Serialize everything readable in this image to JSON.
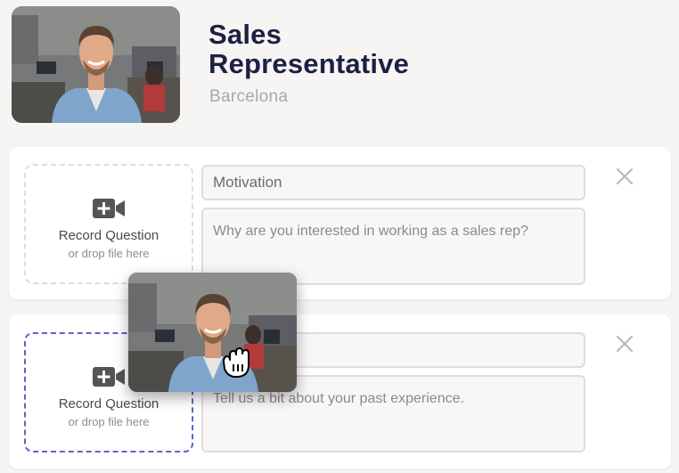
{
  "job": {
    "title": "Sales Representative",
    "location": "Barcelona"
  },
  "questions": [
    {
      "title_value": "Motivation",
      "body_value": "",
      "body_placeholder": "Why are you interested in working as a sales rep?",
      "dropzone": {
        "title": "Record Question",
        "subtitle": "or drop file here",
        "icon": "video-camera-plus-icon"
      },
      "remove_icon": "close-icon"
    },
    {
      "title_value": "",
      "body_value": "",
      "body_placeholder": "Tell us a bit about your past experience.",
      "dropzone": {
        "title": "Record Question",
        "subtitle": "or drop file here",
        "icon": "video-camera-plus-icon",
        "state": "drag-over"
      },
      "remove_icon": "close-icon"
    }
  ],
  "cursor": {
    "type": "grab-hand-icon"
  },
  "colors": {
    "title": "#1c2143",
    "dropzone_active_border": "#5a64cf",
    "dropzone_border": "#dddddd",
    "background": "#f7f5f4"
  }
}
